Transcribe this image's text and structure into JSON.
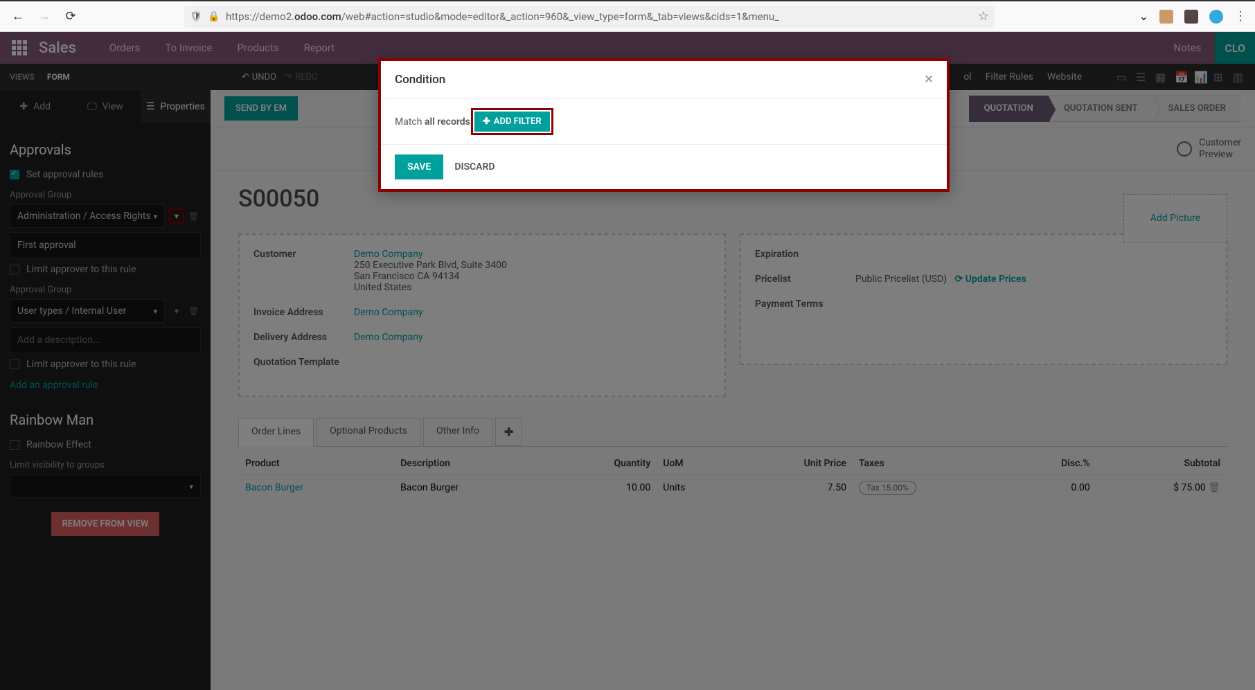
{
  "browser": {
    "url_prefix": "https://demo2.",
    "url_bold": "odoo.com",
    "url_suffix": "/web#action=studio&mode=editor&_action=960&_view_type=form&_tab=views&cids=1&menu_"
  },
  "topnav": {
    "app": "Sales",
    "items": [
      "Orders",
      "To Invoice",
      "Products",
      "Report"
    ],
    "notes": "Notes",
    "close": "CLO"
  },
  "studio": {
    "tab_views": "VIEWS",
    "tab_form": "FORM",
    "undo": "UNDO",
    "redo": "REDO",
    "right": [
      "ol",
      "Filter Rules",
      "Website"
    ]
  },
  "sidebar": {
    "add": "Add",
    "view": "View",
    "properties": "Properties",
    "approvals_title": "Approvals",
    "set_approval": "Set approval rules",
    "group_label": "Approval Group",
    "group1": "Administration / Access Rights",
    "first_approval": "First approval",
    "limit": "Limit approver to this rule",
    "group2": "User types / Internal User",
    "add_desc": "Add a description...",
    "add_rule": "Add an approval rule",
    "rainbow_title": "Rainbow Man",
    "rainbow_effect": "Rainbow Effect",
    "limit_vis": "Limit visibility to groups",
    "remove": "REMOVE FROM VIEW"
  },
  "canvas": {
    "send": "SEND BY EM",
    "stages": [
      "QUOTATION",
      "QUOTATION SENT",
      "SALES ORDER"
    ],
    "preview": "Customer\nPreview",
    "record": "S00050",
    "add_picture": "Add Picture",
    "customer_label": "Customer",
    "customer": "Demo Company",
    "addr1": "250 Executive Park Blvd, Suite 3400",
    "addr2": "San Francisco CA 94134",
    "addr3": "United States",
    "invoice_label": "Invoice Address",
    "invoice": "Demo Company",
    "delivery_label": "Delivery Address",
    "delivery": "Demo Company",
    "template_label": "Quotation Template",
    "exp_label": "Expiration",
    "pricelist_label": "Pricelist",
    "pricelist": "Public Pricelist (USD)",
    "update_prices": "Update Prices",
    "payment_label": "Payment Terms",
    "tabs": [
      "Order Lines",
      "Optional Products",
      "Other Info"
    ],
    "table": {
      "headers": [
        "Product",
        "Description",
        "Quantity",
        "UoM",
        "Unit Price",
        "Taxes",
        "Disc.%",
        "Subtotal"
      ],
      "row": {
        "product": "Bacon Burger",
        "desc": "Bacon Burger",
        "qty": "10.00",
        "uom": "Units",
        "price": "7.50",
        "tax": "Tax 15.00%",
        "disc": "0.00",
        "subtotal": "$ 75.00"
      }
    }
  },
  "modal": {
    "title": "Condition",
    "match": "Match",
    "all": "all records",
    "add_filter": "ADD FILTER",
    "save": "SAVE",
    "discard": "DISCARD"
  }
}
